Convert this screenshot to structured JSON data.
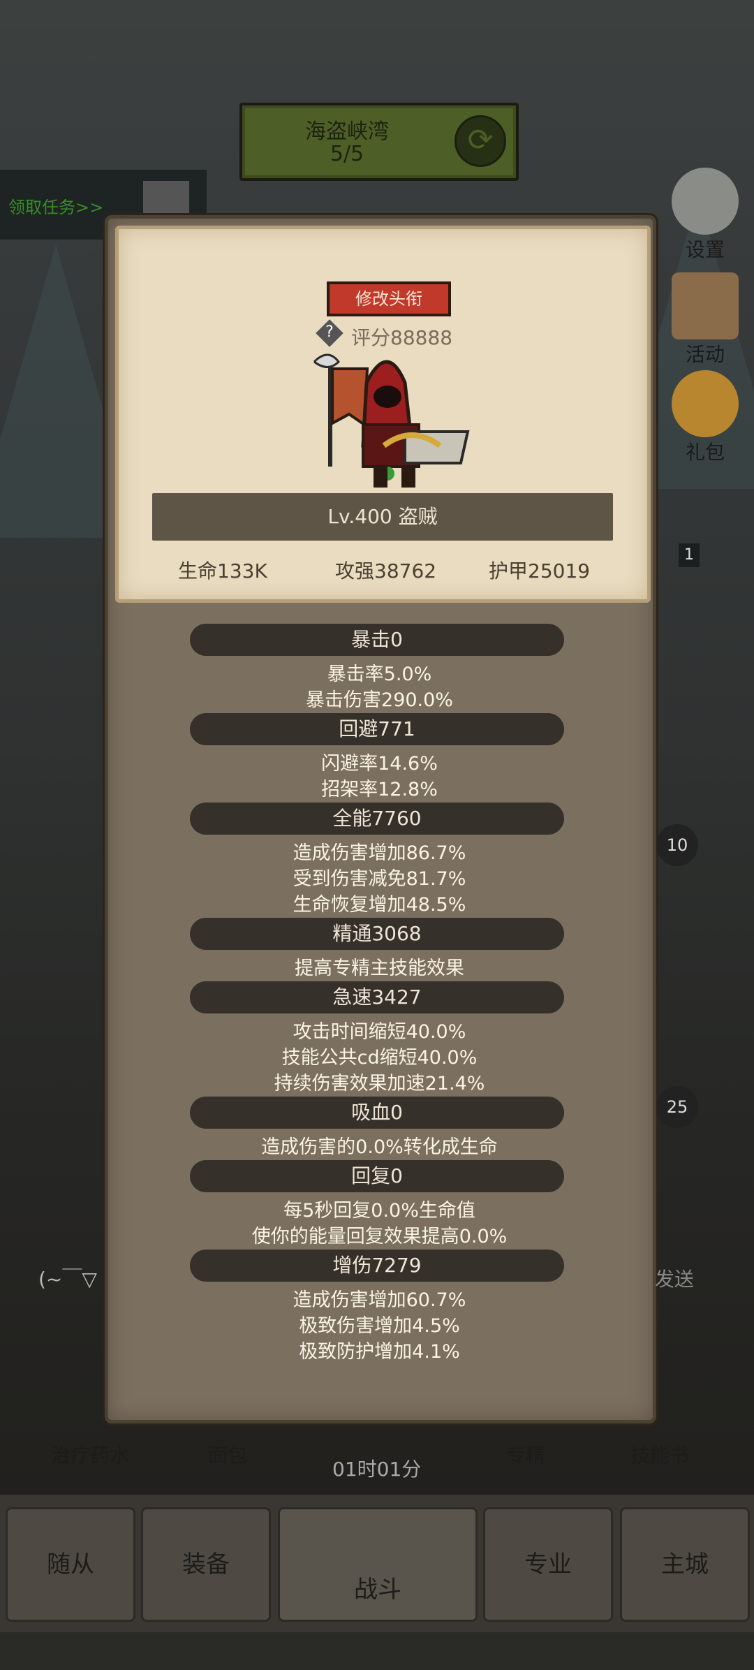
{
  "stage": {
    "name": "海盗峡湾",
    "progress": "5/5"
  },
  "quest": {
    "label": "领取任务>>"
  },
  "side": {
    "settings": "设置",
    "activity": "活动",
    "gift": "礼包"
  },
  "hero": {
    "title_button": "修改头衔",
    "score": "评分88888",
    "level_class": "Lv.400 盗贼",
    "hp": "生命133K",
    "attack": "攻强38762",
    "armor": "护甲25019"
  },
  "sections": [
    {
      "title": "暴击0",
      "lines": [
        "暴击率5.0%",
        "暴击伤害290.0%"
      ]
    },
    {
      "title": "回避771",
      "lines": [
        "闪避率14.6%",
        "招架率12.8%"
      ]
    },
    {
      "title": "全能7760",
      "lines": [
        "造成伤害增加86.7%",
        "受到伤害减免81.7%",
        "生命恢复增加48.5%"
      ]
    },
    {
      "title": "精通3068",
      "lines": [
        "提高专精主技能效果"
      ]
    },
    {
      "title": "急速3427",
      "lines": [
        "攻击时间缩短40.0%",
        "技能公共cd缩短40.0%",
        "持续伤害效果加速21.4%"
      ]
    },
    {
      "title": "吸血0",
      "lines": [
        "造成伤害的0.0%转化成生命"
      ]
    },
    {
      "title": "回复0",
      "lines": [
        "每5秒回复0.0%生命值",
        "使你的能量回复效果提高0.0%"
      ]
    },
    {
      "title": "增伤7279",
      "lines": [
        "造成伤害增加60.7%",
        "极致伤害增加4.5%",
        "极致防护增加4.1%"
      ]
    }
  ],
  "items": {
    "potion": "治疗药水",
    "bread": "面包",
    "timer": "01时01分",
    "spec": "专精",
    "skillbook": "技能书"
  },
  "nav": {
    "follower": "随从",
    "equip": "装备",
    "battle": "战斗",
    "profession": "专业",
    "city": "主城"
  },
  "badges": {
    "b1": "10",
    "b2": "25",
    "lvl": "1"
  },
  "chat": {
    "emote": "(~￣▽",
    "send": "发送"
  }
}
